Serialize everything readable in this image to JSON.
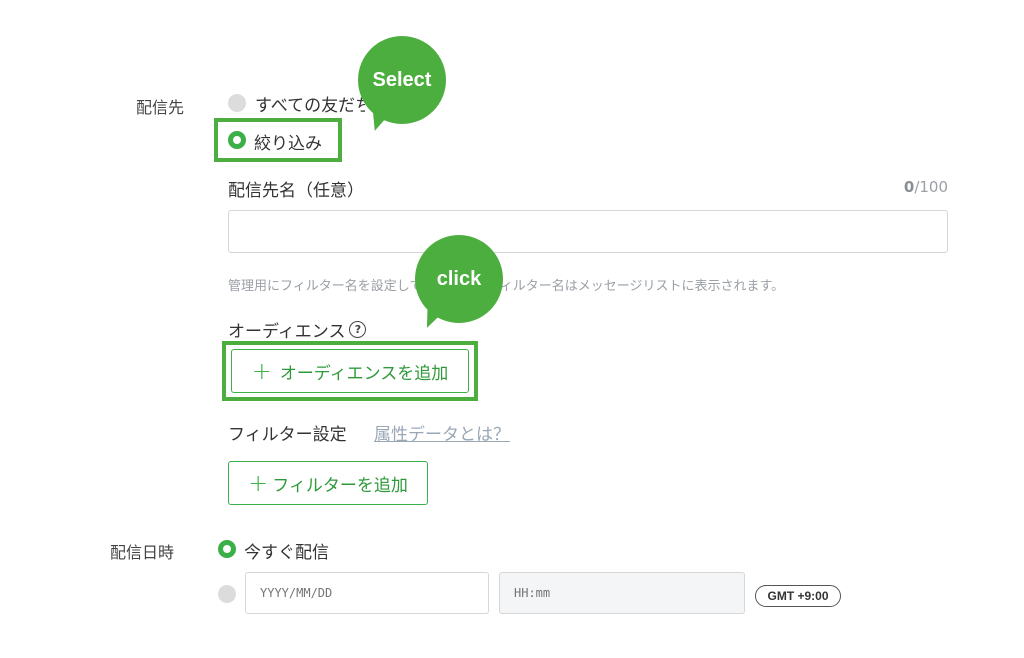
{
  "delivery_target": {
    "label": "配信先",
    "option_all": "すべての友だち",
    "option_narrow": "絞り込み"
  },
  "recipient_name": {
    "label": "配信先名（任意）",
    "count_current": "0",
    "count_max": "/100",
    "placeholder": "",
    "hint": "管理用にフィルター名を設定してください。フィルター名はメッセージリストに表示されます。"
  },
  "audience": {
    "label": "オーディエンス",
    "help_icon": "question-circle-icon",
    "add_button": "オーディエンスを追加"
  },
  "filter": {
    "label": "フィルター設定",
    "link": "属性データとは？",
    "add_button": "フィルターを追加"
  },
  "delivery_time": {
    "label": "配信日時",
    "option_now": "今すぐ配信",
    "date_placeholder": "YYYY/MM/DD",
    "time_placeholder": "HH:mm",
    "timezone": "GMT +9:00"
  },
  "annotations": {
    "select_bubble": "Select",
    "click_bubble": "click",
    "accent_color": "#4cae3e"
  }
}
